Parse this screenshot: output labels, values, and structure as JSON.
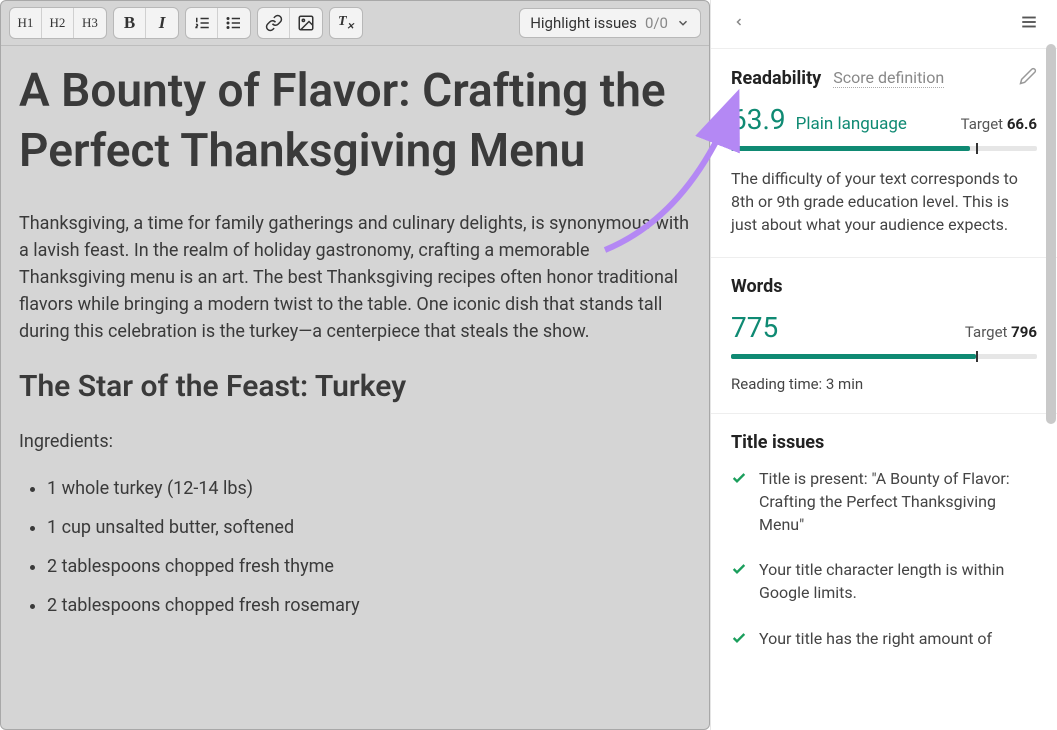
{
  "toolbar": {
    "headings": [
      "H1",
      "H2",
      "H3"
    ],
    "bold": "B",
    "italic": "I",
    "highlight_label": "Highlight issues",
    "highlight_count": "0/0"
  },
  "content": {
    "title": "A Bounty of Flavor: Crafting the Perfect Thanksgiving Menu",
    "intro": "Thanksgiving, a time for family gatherings and culinary delights, is synonymous with a lavish feast. In the realm of holiday gastronomy, crafting a memorable Thanksgiving menu is an art. The best Thanksgiving recipes often honor traditional flavors while bringing a modern twist to the table. One iconic dish that stands tall during this celebration is the turkey—a centerpiece that steals the show.",
    "h2": "The Star of the Feast: Turkey",
    "ingredients_label": "Ingredients:",
    "ingredients": [
      "1 whole turkey (12-14 lbs)",
      "1 cup unsalted butter, softened",
      "2 tablespoons chopped fresh thyme",
      "2 tablespoons chopped fresh rosemary"
    ]
  },
  "sidebar": {
    "readability": {
      "title": "Readability",
      "score_def": "Score definition",
      "score": "63.9",
      "label": "Plain language",
      "target_label": "Target",
      "target": "66.6",
      "fill_pct": 78,
      "target_pct": 80,
      "description": "The difficulty of your text corresponds to 8th or 9th grade education level. This is just about what your audience expects."
    },
    "words": {
      "title": "Words",
      "value": "775",
      "target_label": "Target",
      "target": "796",
      "fill_pct": 80,
      "target_pct": 80,
      "reading_time": "Reading time: 3 min"
    },
    "title_issues": {
      "title": "Title issues",
      "items": [
        "Title is present: \"A Bounty of Flavor: Crafting the Perfect Thanksgiving Menu\"",
        "Your title character length is within Google limits.",
        "Your title has the right amount of"
      ]
    }
  }
}
